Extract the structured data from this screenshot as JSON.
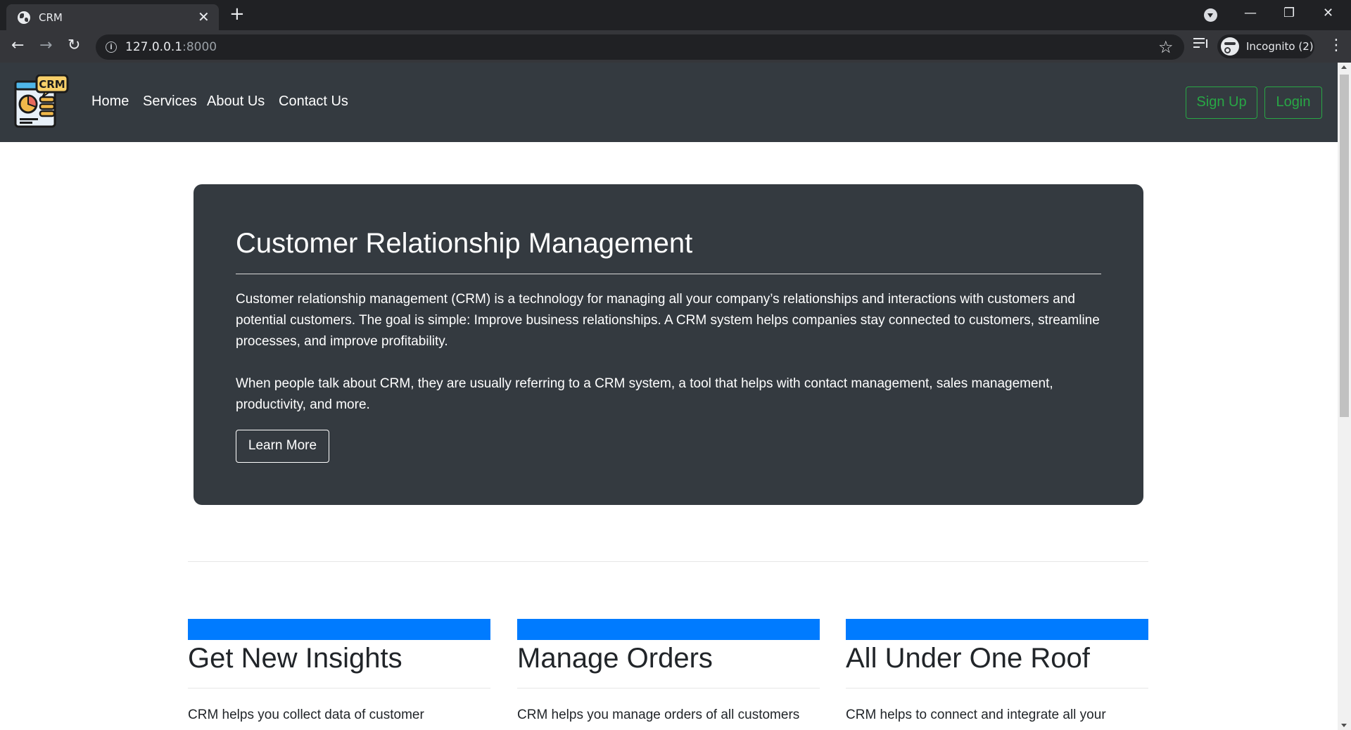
{
  "browser": {
    "tab_title": "CRM",
    "tab_close": "✕",
    "new_tab": "+",
    "url_host": "127.0.0.1",
    "url_port": ":8000",
    "profile_label": "Incognito (2)",
    "minimize": "—",
    "restore": "❐",
    "close": "✕",
    "back": "←",
    "forward": "→",
    "reload": "↻",
    "star": "☆",
    "menu": "⋮",
    "info": "i"
  },
  "navbar": {
    "logo_text": "CRM",
    "links": [
      "Home",
      "Services",
      "About Us",
      "Contact Us"
    ],
    "signup_label": "Sign Up",
    "login_label": "Login",
    "accent_color": "#28a745"
  },
  "jumbotron": {
    "title": "Customer Relationship Management",
    "paragraph1": "Customer relationship management (CRM) is a technology for managing all your company’s relationships and interactions with customers and potential customers. The goal is simple: Improve business relationships. A CRM system helps companies stay connected to customers, streamline processes, and improve profitability.",
    "paragraph2": "When people talk about CRM, they are usually referring to a CRM system, a tool that helps with contact management, sales management, productivity, and more.",
    "button_label": "Learn More",
    "background": "#343a40"
  },
  "features": [
    {
      "title": "Get New Insights",
      "text": "CRM helps you collect data of customer"
    },
    {
      "title": "Manage Orders",
      "text": "CRM helps you manage orders of all customers"
    },
    {
      "title": "All Under One Roof",
      "text": "CRM helps to connect and integrate all your"
    }
  ],
  "feature_bar_color": "#007bff"
}
